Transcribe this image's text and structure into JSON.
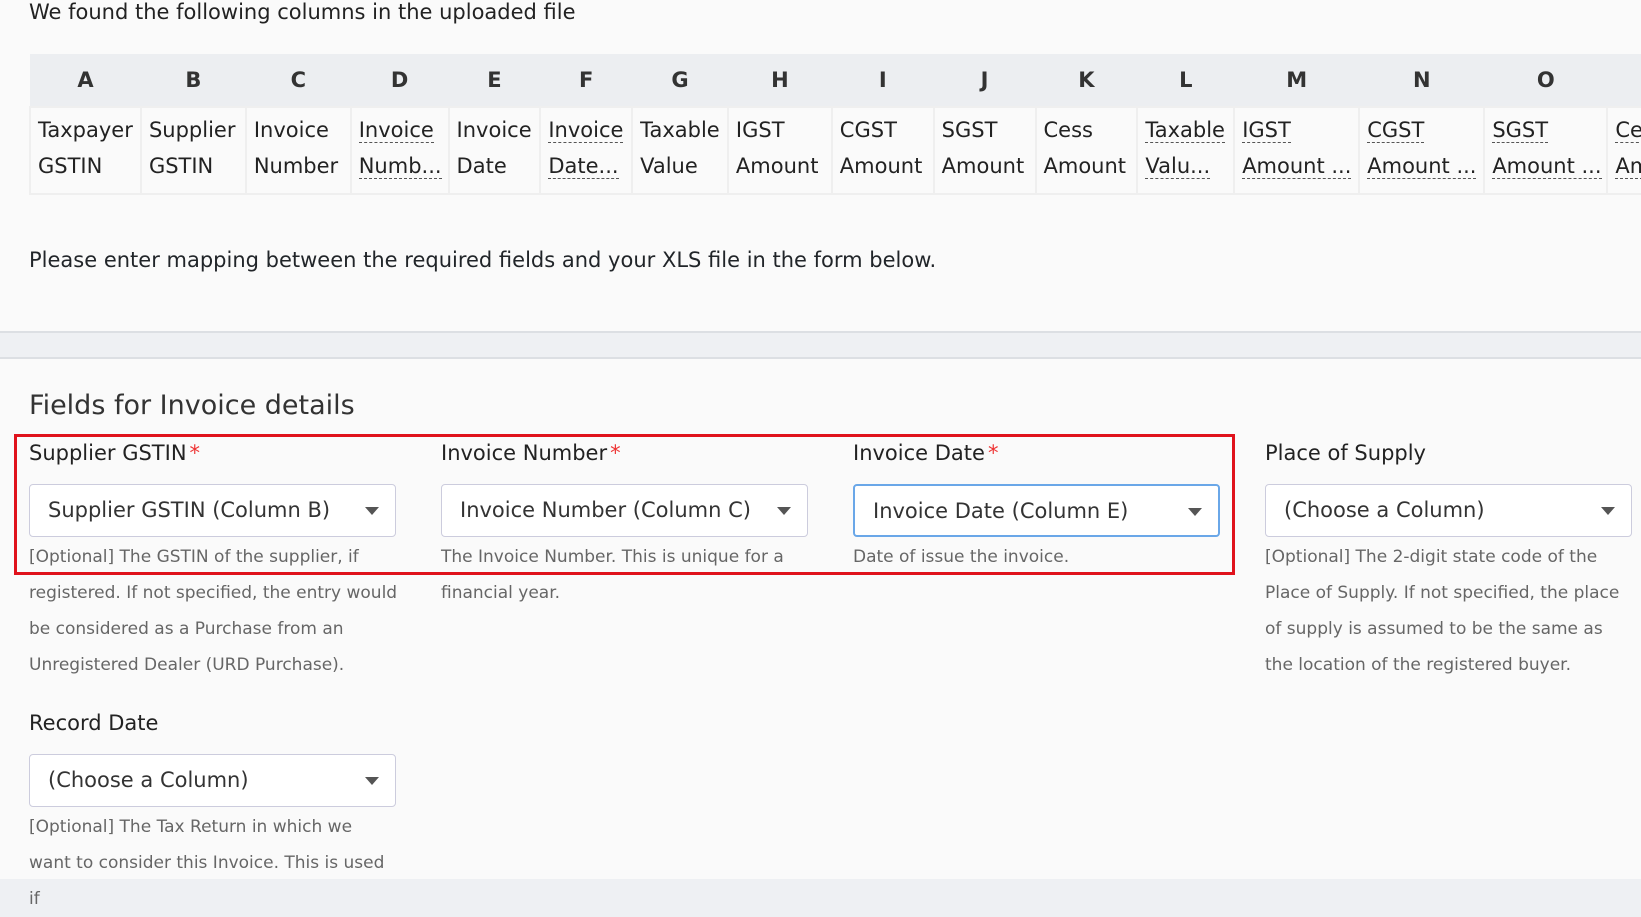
{
  "intro": "We found the following columns in the uploaded file",
  "columns": [
    {
      "letter": "A",
      "l1": "Taxpayer",
      "l2": "GSTIN",
      "abbr": false
    },
    {
      "letter": "B",
      "l1": "Supplier",
      "l2": "GSTIN",
      "abbr": false
    },
    {
      "letter": "C",
      "l1": "Invoice",
      "l2": "Number",
      "abbr": false
    },
    {
      "letter": "D",
      "l1": "Invoice",
      "l2": "Numb...",
      "abbr": true
    },
    {
      "letter": "E",
      "l1": "Invoice",
      "l2": "Date",
      "abbr": false
    },
    {
      "letter": "F",
      "l1": "Invoice",
      "l2": "Date...",
      "abbr": true
    },
    {
      "letter": "G",
      "l1": "Taxable",
      "l2": "Value",
      "abbr": false
    },
    {
      "letter": "H",
      "l1": "IGST",
      "l2": "Amount",
      "abbr": false
    },
    {
      "letter": "I",
      "l1": "CGST",
      "l2": "Amount",
      "abbr": false
    },
    {
      "letter": "J",
      "l1": "SGST",
      "l2": "Amount",
      "abbr": false
    },
    {
      "letter": "K",
      "l1": "Cess",
      "l2": "Amount",
      "abbr": false
    },
    {
      "letter": "L",
      "l1": "Taxable",
      "l2": "Valu...",
      "abbr": true
    },
    {
      "letter": "M",
      "l1": "IGST",
      "l2": "Amount ...",
      "abbr": true
    },
    {
      "letter": "N",
      "l1": "CGST",
      "l2": "Amount ...",
      "abbr": true
    },
    {
      "letter": "O",
      "l1": "SGST",
      "l2": "Amount ...",
      "abbr": true
    },
    {
      "letter": "",
      "l1": "Cess",
      "l2": "Amount",
      "abbr": true
    }
  ],
  "please": "Please enter mapping between the required fields and your XLS file in the form below.",
  "section_title": "Fields for Invoice details",
  "required_mark": "*",
  "fields": [
    {
      "label": "Supplier GSTIN",
      "required": true,
      "value": "Supplier GSTIN (Column B)",
      "help": "[Optional] The GSTIN of the supplier, if registered. If not specified, the entry would be considered as a Purchase from an Unregistered Dealer (URD Purchase)."
    },
    {
      "label": "Invoice Number",
      "required": true,
      "value": "Invoice Number (Column C)",
      "help": "The Invoice Number. This is unique for a financial year."
    },
    {
      "label": "Invoice Date",
      "required": true,
      "value": "Invoice Date (Column E)",
      "help": "Date of issue the invoice.",
      "focused": true
    },
    {
      "label": "Place of Supply",
      "required": false,
      "value": "(Choose a Column)",
      "help": "[Optional] The 2-digit state code of the Place of Supply. If not specified, the place of supply is assumed to be the same as the location of the registered buyer."
    },
    {
      "label": "Record Date",
      "required": false,
      "value": "(Choose a Column)",
      "help": "[Optional] The Tax Return in which we want to consider this Invoice. This is used if"
    }
  ],
  "highlight_color": "#e0121c"
}
